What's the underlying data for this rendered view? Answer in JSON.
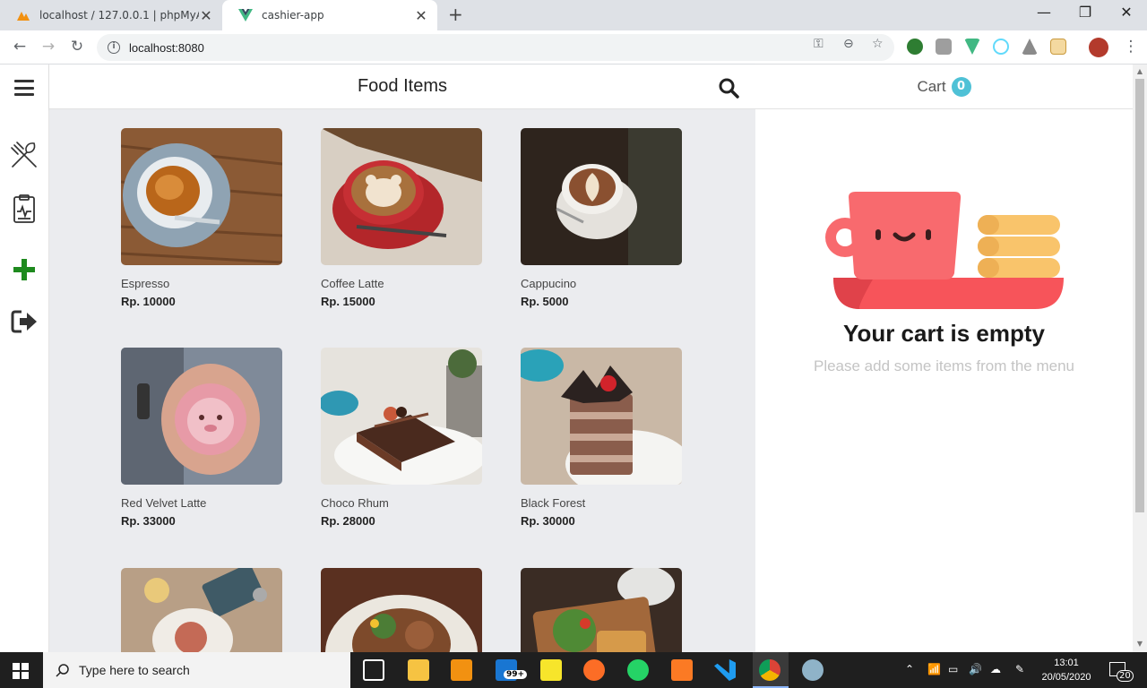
{
  "browser": {
    "tabs": [
      {
        "title": "localhost / 127.0.0.1 | phpMyAdmin",
        "active": false
      },
      {
        "title": "cashier-app",
        "active": true
      }
    ],
    "address": "localhost:8080"
  },
  "app": {
    "header_title": "Food Items",
    "sidebar_icons": [
      "menu-icon",
      "utensils-icon",
      "report-icon",
      "plus-icon",
      "logout-icon"
    ],
    "items": [
      {
        "name": "Espresso",
        "price": "Rp. 10000"
      },
      {
        "name": "Coffee Latte",
        "price": "Rp. 15000"
      },
      {
        "name": "Cappucino",
        "price": "Rp. 5000"
      },
      {
        "name": "Red Velvet Latte",
        "price": "Rp. 33000"
      },
      {
        "name": "Choco Rhum",
        "price": "Rp. 28000"
      },
      {
        "name": "Black Forest",
        "price": "Rp. 30000"
      },
      {
        "name": "",
        "price": ""
      },
      {
        "name": "",
        "price": ""
      },
      {
        "name": "",
        "price": ""
      }
    ],
    "cart": {
      "label": "Cart",
      "count": "0",
      "empty_title": "Your cart is empty",
      "empty_subtitle": "Please add some items from the menu"
    }
  },
  "taskbar": {
    "search_placeholder": "Type here to search",
    "mail_badge": "99+",
    "time": "13:01",
    "date": "20/05/2020",
    "notifications": "20"
  },
  "colors": {
    "accent": "#4fc1d6",
    "add_green": "#1e8a1e",
    "cup_pink": "#f86a6e",
    "cookie_yellow": "#f9c46b"
  }
}
